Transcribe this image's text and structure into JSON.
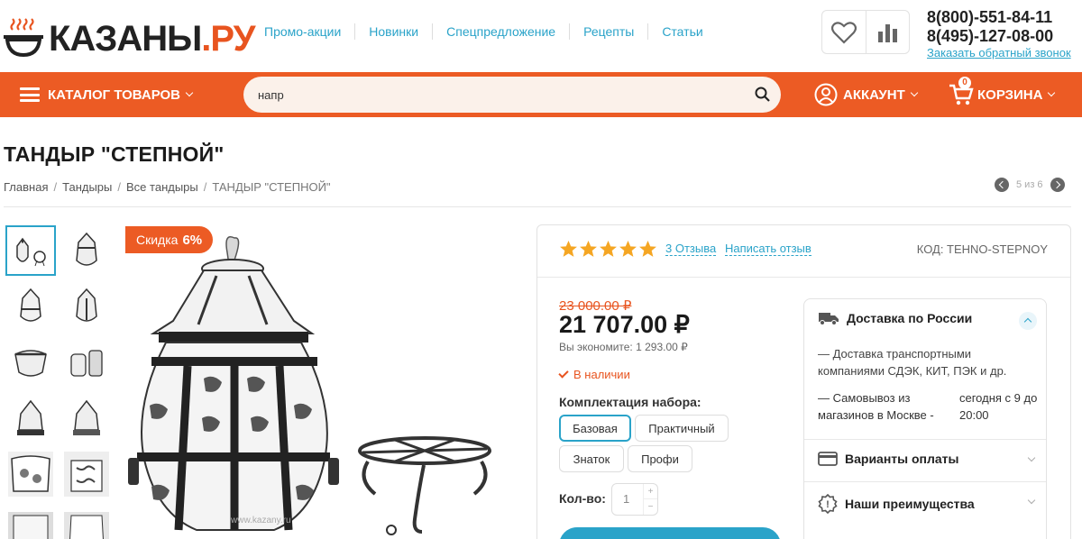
{
  "header": {
    "logo": {
      "brand": "КАЗАНЫ",
      "suffix": ".РУ"
    },
    "nav": [
      "Промо-акции",
      "Новинки",
      "Спецпредложение",
      "Рецепты",
      "Статьи"
    ],
    "phones": [
      "8(800)-551-84-11",
      "8(495)-127-08-00"
    ],
    "callback": "Заказать обратный звонок"
  },
  "menubar": {
    "catalog": "КАТАЛОГ ТОВАРОВ",
    "search_value": "напр",
    "account": "АККАУНТ",
    "cart": "КОРЗИНА",
    "cart_count": "0"
  },
  "product": {
    "title": "ТАНДЫР \"СТЕПНОЙ\"",
    "breadcrumbs": [
      "Главная",
      "Тандыры",
      "Все тандыры",
      "ТАНДЫР \"СТЕПНОЙ\""
    ],
    "pager": "5 из 6",
    "discount_label": "Скидка",
    "discount_value": "6%",
    "rating": 5,
    "reviews": "3 Отзыва",
    "write_review": "Написать отзыв",
    "sku": "КОД: TEHNO-STEPNOY",
    "old_price": "23 000.00 ₽",
    "price": "21 707.00 ₽",
    "savings": "Вы экономите: 1 293.00 ₽",
    "stock": "В наличии",
    "set_label": "Комплектация набора:",
    "options": [
      "Базовая",
      "Практичный",
      "Знаток",
      "Профи"
    ],
    "selected_option": "Базовая",
    "qty_label": "Кол-во:",
    "qty_value": "1",
    "qty_plus": "+",
    "qty_minus": "−",
    "watermark": "www.kazany.ru"
  },
  "delivery": {
    "title": "Доставка по России",
    "text": "— Доставка транспортными компаниями СДЭК, КИТ, ПЭК и др.",
    "pickup": "— Самовывоз из магазинов в Москве -",
    "pickup_time": "сегодня с 9 до 20:00",
    "payment": "Варианты оплаты",
    "advantages": "Наши преимущества"
  },
  "colors": {
    "accent": "#ec5b24",
    "link": "#2aa3c9",
    "star": "#f5a623"
  }
}
